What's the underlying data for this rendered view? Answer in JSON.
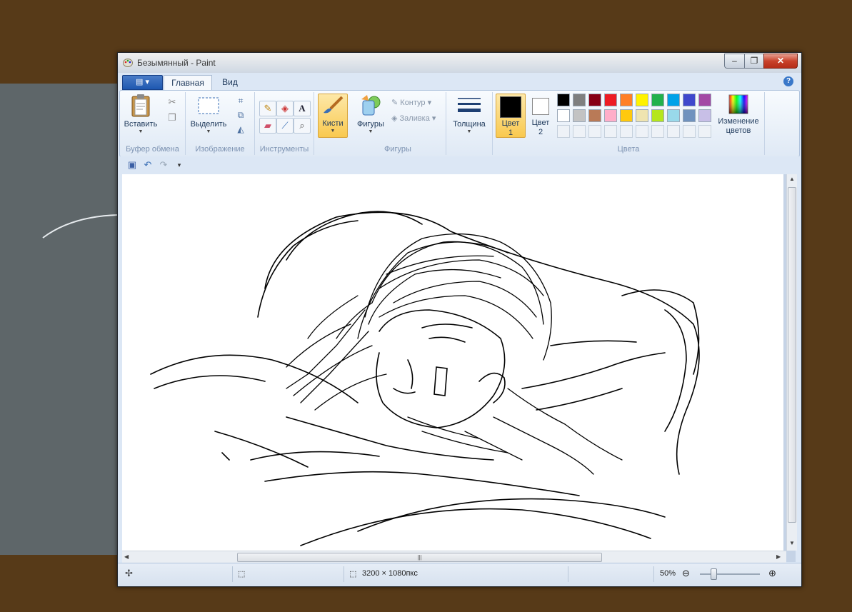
{
  "window": {
    "title": "Безымянный - Paint",
    "min": "–",
    "max": "❐",
    "close": "✕"
  },
  "tabs": {
    "app_menu": "▤ ▾",
    "home": "Главная",
    "view": "Вид",
    "help": "?"
  },
  "ribbon": {
    "clipboard": {
      "paste": "Вставить",
      "label": "Буфер обмена"
    },
    "image": {
      "select": "Выделить",
      "label": "Изображение"
    },
    "tools": {
      "label": "Инструменты"
    },
    "brushes": {
      "label": "Кисти"
    },
    "shapes": {
      "shapes": "Фигуры",
      "outline": "Контур",
      "fill": "Заливка",
      "label": "Фигуры"
    },
    "size": {
      "label": "Толщина"
    },
    "colors": {
      "color1_line1": "Цвет",
      "color1_line2": "1",
      "color2_line1": "Цвет",
      "color2_line2": "2",
      "edit_line1": "Изменение",
      "edit_line2": "цветов",
      "label": "Цвета",
      "row1": [
        "#000000",
        "#7f7f7f",
        "#880015",
        "#ed1c24",
        "#ff7f27",
        "#fff200",
        "#22b14c",
        "#00a2e8",
        "#3f48cc",
        "#a349a4"
      ],
      "row2": [
        "#ffffff",
        "#c3c3c3",
        "#b97a57",
        "#ffaec9",
        "#ffc90e",
        "#efe4b0",
        "#b5e61d",
        "#99d9ea",
        "#7092be",
        "#c8bfe7"
      ]
    }
  },
  "status": {
    "dimensions": "3200 × 1080пкс",
    "zoom": "50%"
  }
}
